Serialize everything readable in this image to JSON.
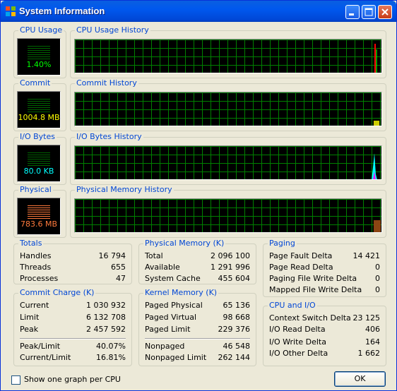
{
  "window": {
    "title": "System Information"
  },
  "meters": {
    "cpu": {
      "label": "CPU Usage",
      "value": "1.40%",
      "history_label": "CPU Usage History"
    },
    "commit": {
      "label": "Commit",
      "value": "1004.8 MB",
      "history_label": "Commit History"
    },
    "io": {
      "label": "I/O Bytes",
      "value": "80.0  KB",
      "history_label": "I/O Bytes History"
    },
    "physical": {
      "label": "Physical",
      "value": "783.6 MB",
      "history_label": "Physical Memory History"
    }
  },
  "totals": {
    "label": "Totals",
    "rows": [
      {
        "k": "Handles",
        "v": "16 794"
      },
      {
        "k": "Threads",
        "v": "655"
      },
      {
        "k": "Processes",
        "v": "47"
      }
    ]
  },
  "physical_memory": {
    "label": "Physical Memory (K)",
    "rows": [
      {
        "k": "Total",
        "v": "2 096 100"
      },
      {
        "k": "Available",
        "v": "1 291 996"
      },
      {
        "k": "System Cache",
        "v": "455 604"
      }
    ]
  },
  "paging": {
    "label": "Paging",
    "rows": [
      {
        "k": "Page Fault Delta",
        "v": "14 421"
      },
      {
        "k": "Page Read Delta",
        "v": "0"
      },
      {
        "k": "Paging File Write Delta",
        "v": "0"
      },
      {
        "k": "Mapped File Write Delta",
        "v": "0"
      }
    ]
  },
  "commit_charge": {
    "label": "Commit Charge (K)",
    "rows": [
      {
        "k": "Current",
        "v": "1 030 932"
      },
      {
        "k": "Limit",
        "v": "6 132 708"
      },
      {
        "k": "Peak",
        "v": "2 457 592"
      },
      {
        "k": "Peak/Limit",
        "v": "40.07%"
      },
      {
        "k": "Current/Limit",
        "v": "16.81%"
      }
    ]
  },
  "kernel_memory": {
    "label": "Kernel Memory (K)",
    "rows": [
      {
        "k": "Paged Physical",
        "v": "65 136"
      },
      {
        "k": "Paged Virtual",
        "v": "98 668"
      },
      {
        "k": "Paged Limit",
        "v": "229 376"
      },
      {
        "k": "Nonpaged",
        "v": "46 548"
      },
      {
        "k": "Nonpaged Limit",
        "v": "262 144"
      }
    ]
  },
  "cpu_io": {
    "label": "CPU and I/O",
    "rows": [
      {
        "k": "Context Switch Delta",
        "v": "23 125"
      },
      {
        "k": "I/O Read Delta",
        "v": "406"
      },
      {
        "k": "I/O Write Delta",
        "v": "164"
      },
      {
        "k": "I/O Other Delta",
        "v": "1 662"
      }
    ]
  },
  "footer": {
    "checkbox_label": "Show one graph per CPU",
    "ok_label": "OK"
  },
  "colors": {
    "cpu": "#00ff00",
    "commit": "#ffff00",
    "io": "#00ffff",
    "physical": "#ff7a3c"
  }
}
